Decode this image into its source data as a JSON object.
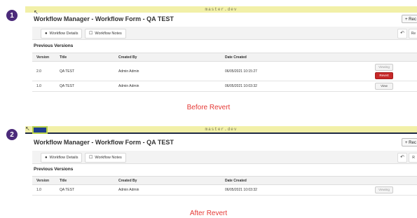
{
  "steps": [
    "1",
    "2"
  ],
  "before": {
    "env_label": "master.dev",
    "title": "Workflow Manager - Workflow Form - QA TEST",
    "rec_label": "Rec",
    "tabs": [
      "Workflow Details",
      "Workflow Notes"
    ],
    "right_tab": "Re",
    "section": "Previous Versions",
    "columns": [
      "Version",
      "Title",
      "Created By",
      "Date Created"
    ],
    "rows": [
      {
        "version": "2.0",
        "title": "QA TEST",
        "created_by": "Admin Admin",
        "date": "06/05/2021 10:15:27",
        "actions": [
          "Viewing",
          "Revert"
        ]
      },
      {
        "version": "1.0",
        "title": "QA TEST",
        "created_by": "Admin Admin",
        "date": "06/05/2021 10:03:32",
        "actions": [
          "View"
        ]
      }
    ],
    "caption": "Before Revert"
  },
  "after": {
    "env_label": "master.dev",
    "title": "Workflow Manager - Workflow Form - QA TEST",
    "rec_label": "Rec",
    "tabs": [
      "Workflow Details",
      "Workflow Notes"
    ],
    "right_tab": "R",
    "section": "Previous Versions",
    "columns": [
      "Version",
      "Title",
      "Created By",
      "Date Created"
    ],
    "rows": [
      {
        "version": "1.0",
        "title": "QA TEST",
        "created_by": "Admin Admin",
        "date": "06/05/2021 10:03:32",
        "actions": [
          "Viewing"
        ]
      }
    ],
    "caption": "After Revert"
  },
  "icons": {
    "info": "info-icon",
    "note": "note-icon",
    "history": "history-icon",
    "plus": "plus-icon"
  },
  "colors": {
    "badge": "#4b2a7a",
    "revert": "#c62828",
    "caption": "#e53935",
    "env_strip": "#f2f0a8"
  }
}
